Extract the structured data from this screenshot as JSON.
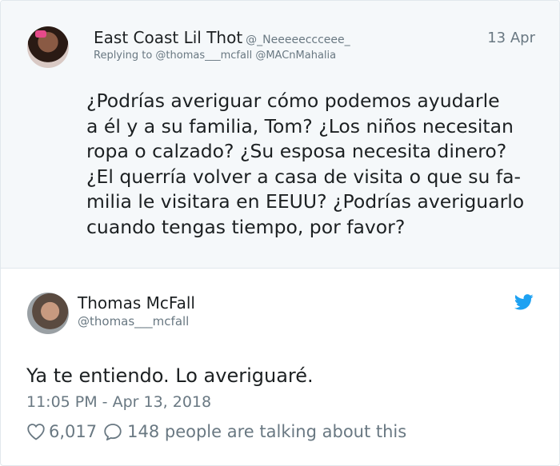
{
  "quoted_tweet": {
    "author_name": "East Coast Lil Thot",
    "author_handle": "@_Neeeeeccceee_",
    "date": "13 Apr",
    "reply_to": "Replying to @thomas___mcfall @MACnMahalia",
    "body_lines": [
      "¿Podrías averiguar cómo podemos ayudarle",
      "a él y a su familia, Tom? ¿Los niños necesitan",
      "ropa o calzado? ¿Su esposa necesita dinero?",
      "¿El querría volver a casa de visita o que su fa-",
      "milia le visitara en EEUU? ¿Podrías averiguarlo",
      "cuando tengas tiempo, por favor?"
    ]
  },
  "main_tweet": {
    "author_name": "Thomas McFall",
    "author_handle": "@thomas___mcfall",
    "text": "Ya te entiendo. Lo averiguaré.",
    "timestamp": "11:05 PM - Apr 13, 2018",
    "likes": "6,017",
    "talking": "148 people are talking about this"
  },
  "icons": {
    "brand": "twitter-bird-icon",
    "like": "heart-icon",
    "reply": "speech-bubble-icon"
  },
  "colors": {
    "brand_blue": "#1da1f2",
    "muted_text": "#697882",
    "quoted_bg": "#f5f8fa"
  }
}
